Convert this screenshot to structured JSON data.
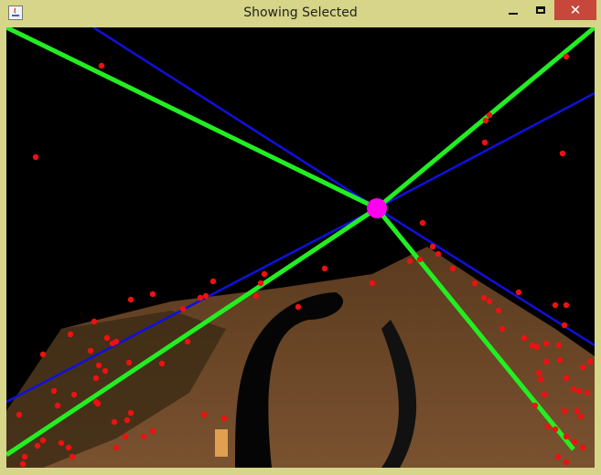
{
  "window": {
    "title": "Showing Selected",
    "controls": {
      "minimize": "minimize",
      "maximize": "maximize",
      "close": "✕"
    }
  },
  "scene": {
    "background_color": "#000000",
    "line_colors": {
      "green": "#22ee22",
      "blue": "#1010dd"
    },
    "vanishing_point_color": "#ff00ee",
    "feature_point_color": "#ee1111"
  }
}
